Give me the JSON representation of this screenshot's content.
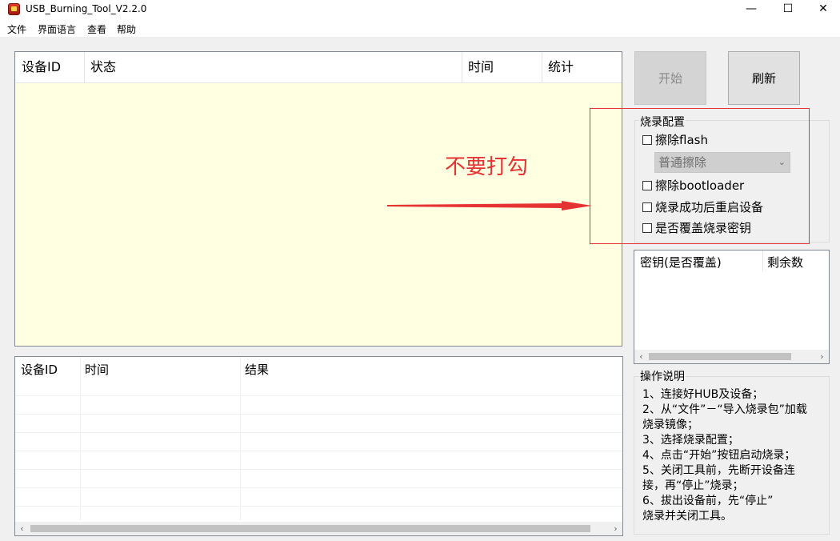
{
  "window": {
    "title": "USB_Burning_Tool_V2.2.0",
    "controls": {
      "minimize": "—",
      "maximize": "☐",
      "close": "✕"
    }
  },
  "menu": [
    "文件",
    "界面语言",
    "查看",
    "帮助"
  ],
  "device_table": {
    "columns": [
      "设备ID",
      "状态",
      "时间",
      "统计"
    ],
    "background": "#ffffe1"
  },
  "buttons": {
    "start": "开始",
    "refresh": "刷新"
  },
  "config": {
    "title": "烧录配置",
    "erase_flash": "擦除flash",
    "erase_mode": "普通擦除",
    "erase_bootloader": "擦除bootloader",
    "reboot_after": "烧录成功后重启设备",
    "overwrite_key": "是否覆盖烧录密钥"
  },
  "key_table": {
    "columns": [
      "密钥(是否覆盖)",
      "剩余数"
    ]
  },
  "result_table": {
    "columns": [
      "设备ID",
      "时间",
      "结果"
    ]
  },
  "help": {
    "title": "操作说明",
    "lines": [
      "1、连接好HUB及设备；",
      "2、从“文件”－“导入烧录包”加载",
      "烧录镜像；",
      "3、选择烧录配置；",
      "4、点击“开始”按钮启动烧录；",
      "5、关闭工具前，先断开设备连",
      "接，再“停止”烧录；",
      "6、拔出设备前，先“停止”",
      "烧录并关闭工具。"
    ]
  },
  "annotation": {
    "text": "不要打勾",
    "color": "#e53333"
  }
}
